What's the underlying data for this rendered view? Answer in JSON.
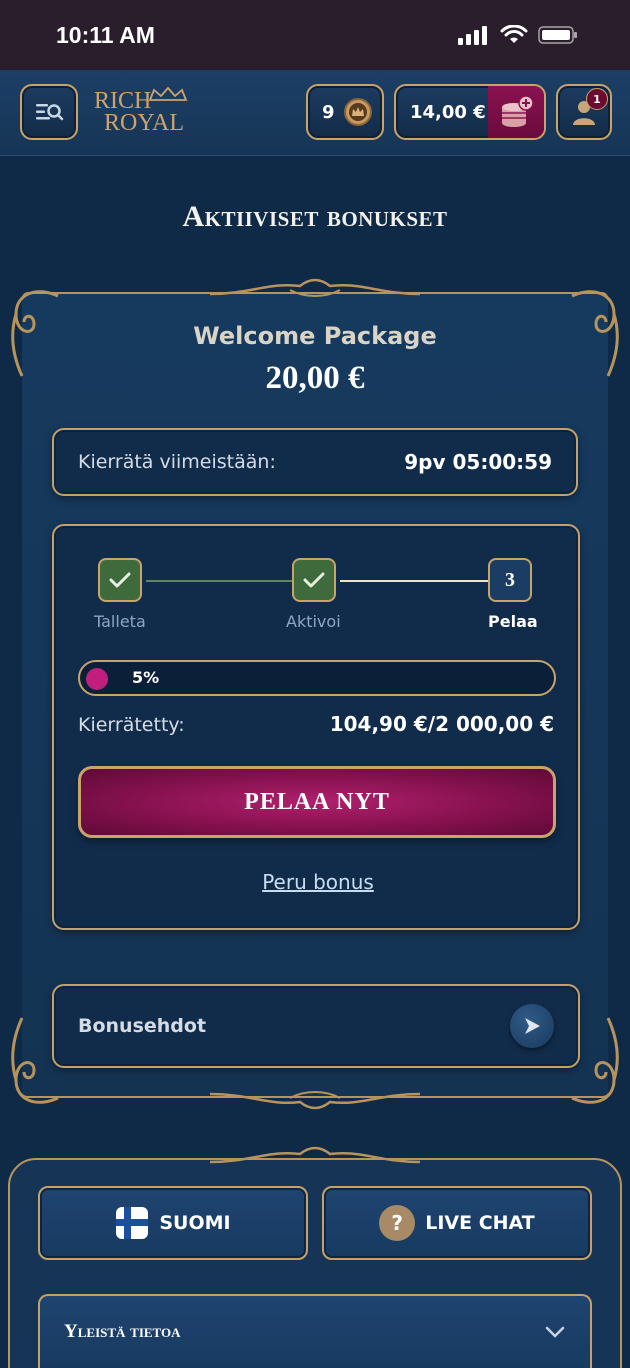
{
  "status_bar": {
    "time": "10:11 AM"
  },
  "header": {
    "logo_line1": "RICH",
    "logo_line2": "ROYAL",
    "coins_count": "9",
    "balance": "14,00 €",
    "notification_count": "1"
  },
  "page_title": "Aktiiviset bonukset",
  "bonus": {
    "name": "Welcome Package",
    "amount": "20,00 €",
    "deadline_label": "Kierrätä viimeistään:",
    "deadline_value": "9pv 05:00:59",
    "steps": [
      {
        "label": "Talleta",
        "state": "done"
      },
      {
        "label": "Aktivoi",
        "state": "done"
      },
      {
        "label": "Pelaa",
        "state": "current",
        "number": "3"
      }
    ],
    "progress_percent_label": "5%",
    "progress_fraction": 0.05,
    "wagered_label": "Kierrätetty:",
    "wagered_value": "104,90 €/2 000,00 €",
    "play_button": "PELAA NYT",
    "cancel_link": "Peru bonus",
    "terms_label": "Bonusehdot"
  },
  "footer": {
    "language_button": "SUOMI",
    "live_chat_button": "LIVE CHAT",
    "help_symbol": "?",
    "general_info": "Yleistä tietoa"
  },
  "colors": {
    "background": "#0f2a47",
    "gold": "#c8a46a",
    "primary_button": "#86114f",
    "step_done": "#3f6b3c",
    "progress_fill": "#c21e7d"
  },
  "icons": [
    "signal-icon",
    "wifi-icon",
    "battery-icon",
    "menu-search-icon",
    "crown-coin-icon",
    "coin-stack-plus-icon",
    "user-icon",
    "check-icon",
    "chevron-right-icon",
    "finland-flag-icon",
    "help-icon",
    "chevron-down-icon"
  ]
}
